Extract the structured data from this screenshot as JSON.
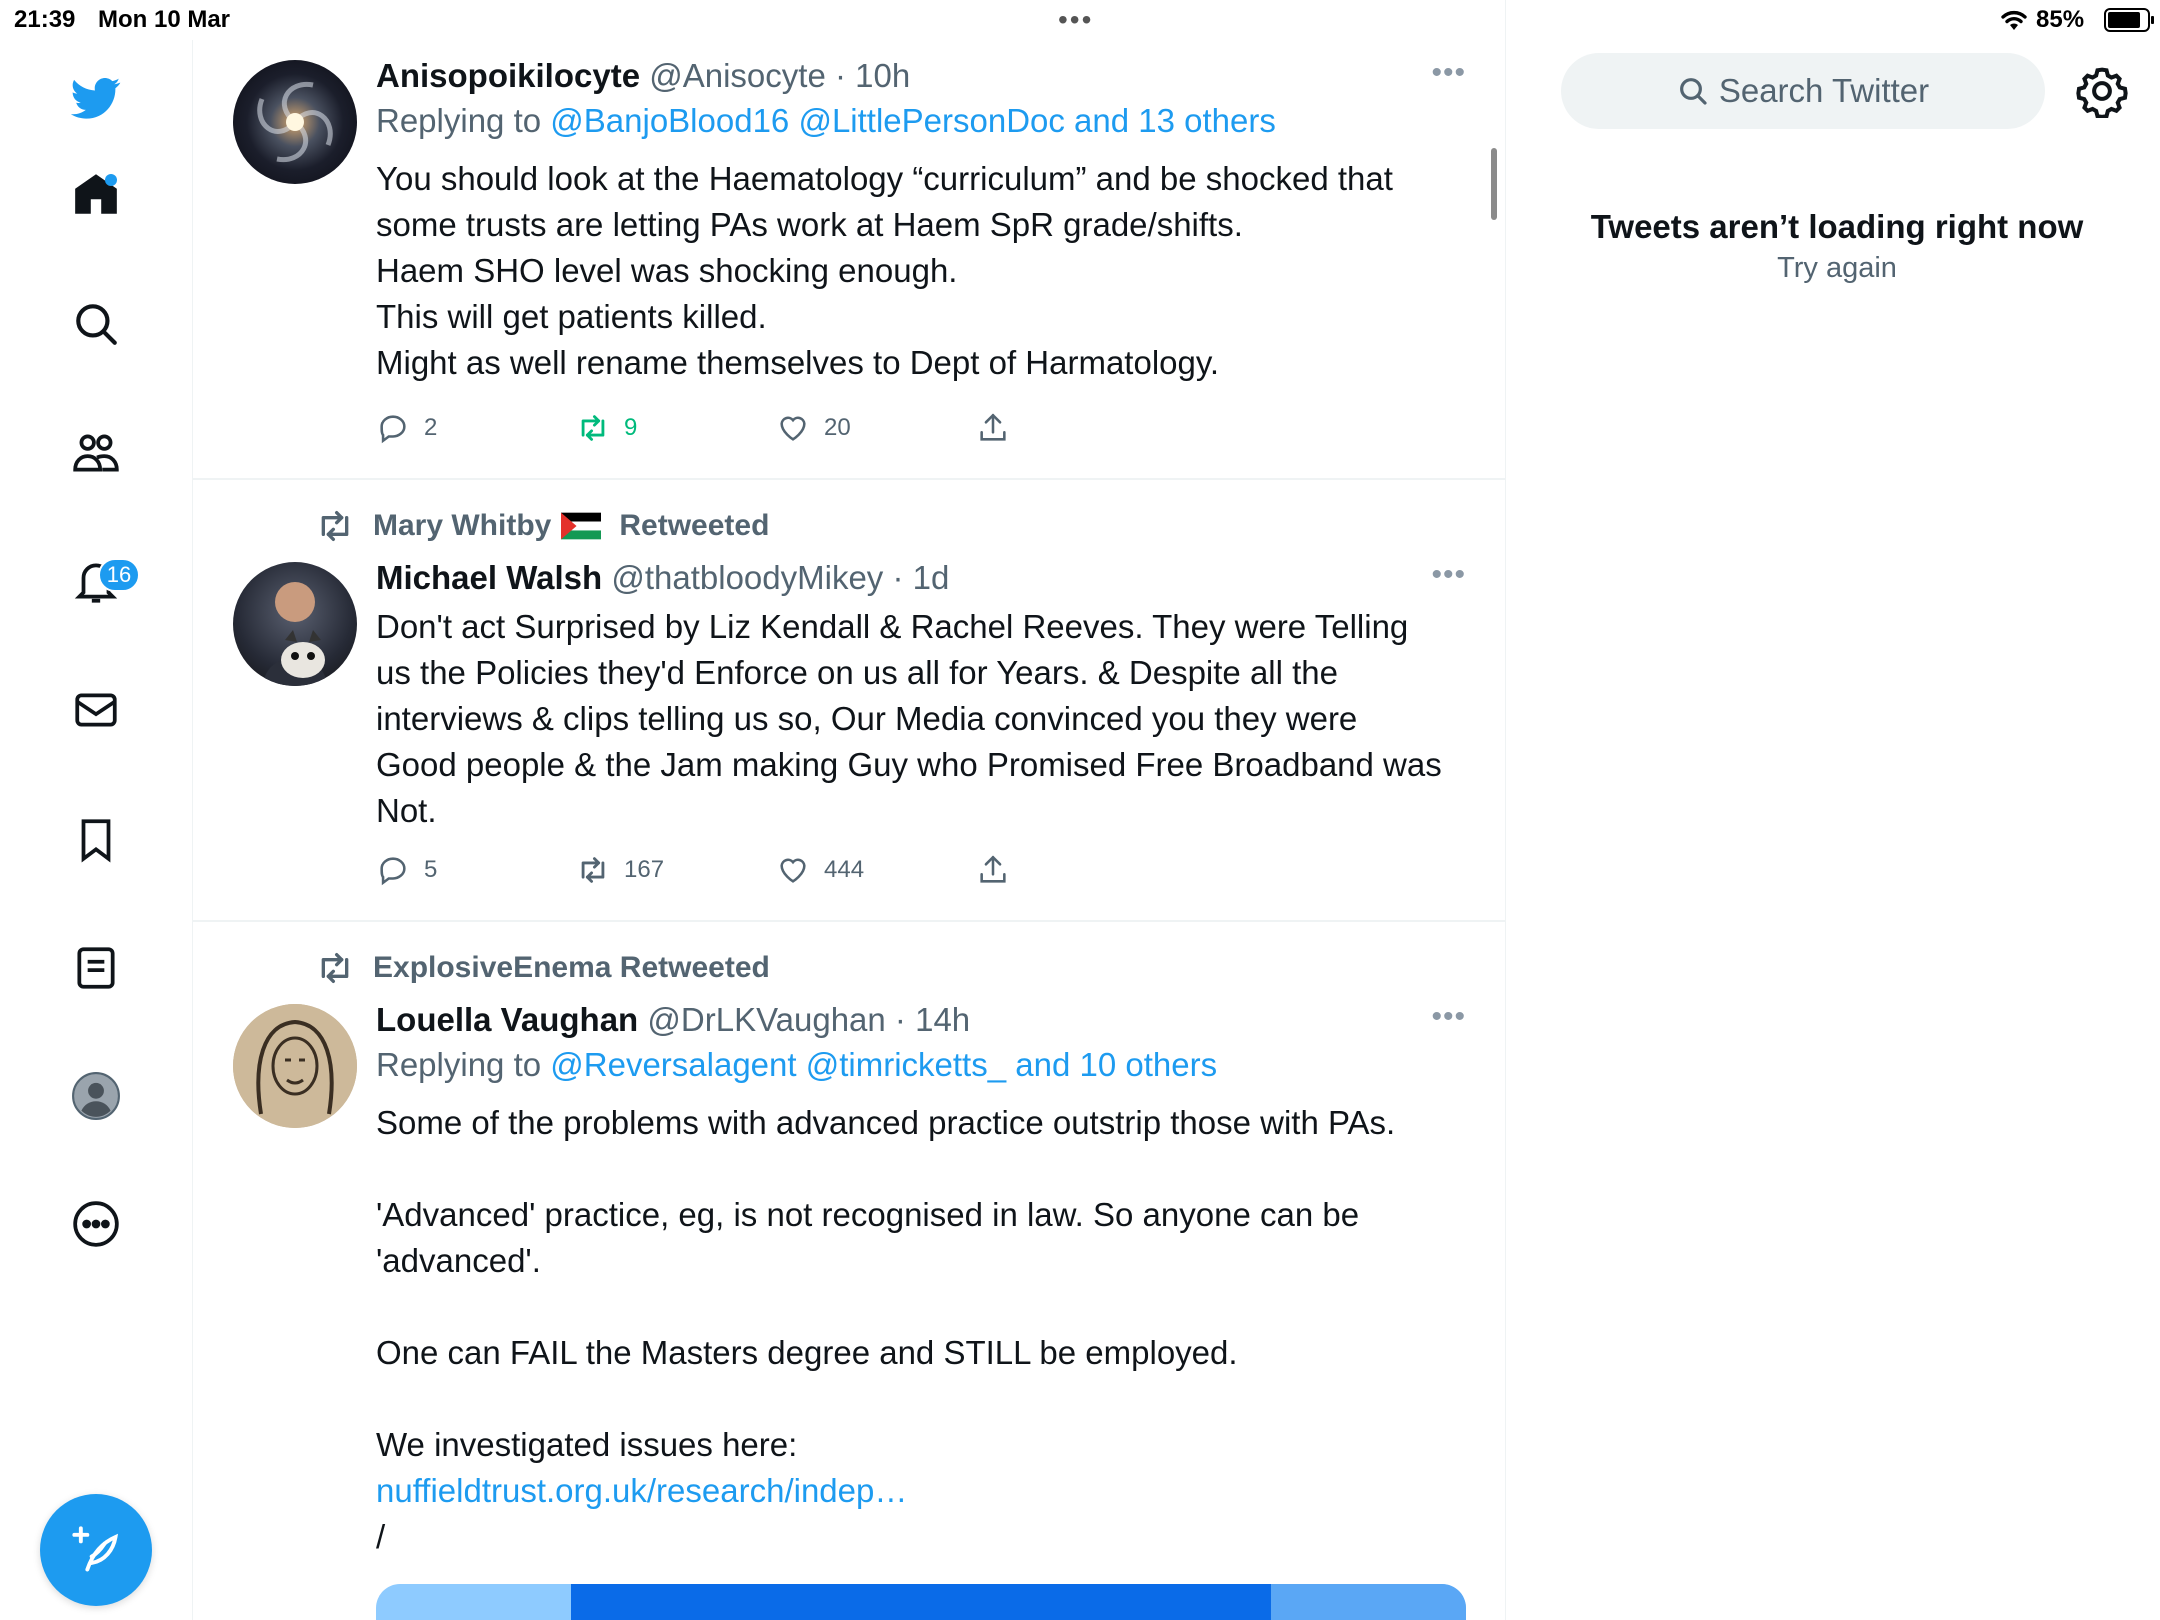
{
  "status_bar": {
    "time": "21:39",
    "date": "Mon 10 Mar",
    "battery_percent": "85%",
    "battery_level": 0.85
  },
  "nav": {
    "notifications_badge": "16",
    "icons": [
      "twitter-bird-icon",
      "home-icon",
      "search-icon",
      "communities-icon",
      "notifications-icon",
      "messages-icon",
      "bookmarks-icon",
      "lists-icon",
      "profile-icon",
      "more-icon"
    ]
  },
  "tweets": [
    {
      "name": "Anisopoikilocyte",
      "handle": "@Anisocyte",
      "sep": " · ",
      "time": "10h",
      "replying_prefix": "Replying to ",
      "replying_mentions": "@BanjoBlood16 @LittlePersonDoc and 13 others",
      "text": "You should look at the Haematology “curriculum” and be shocked that\nsome trusts are letting PAs work at Haem SpR grade/shifts.\nHaem SHO level was shocking enough.\nThis will get patients killed.\nMight as well rename themselves to Dept of Harmatology.",
      "replies": "2",
      "retweets": "9",
      "likes": "20"
    },
    {
      "retweeted_by": "Mary Whitby",
      "retweeted_suffix": "Retweeted",
      "name": "Michael Walsh",
      "handle": "@thatbloodyMikey",
      "sep": " · ",
      "time": "1d",
      "text": "Don't act Surprised by Liz Kendall & Rachel Reeves. They were Telling\nus the Policies they'd Enforce on us all for Years. & Despite all the\ninterviews & clips telling us so, Our Media convinced you they were\nGood people & the Jam making Guy who Promised Free Broadband was\nNot.",
      "replies": "5",
      "retweets": "167",
      "likes": "444"
    },
    {
      "retweeted_by": "ExplosiveEnema",
      "retweeted_suffix": "Retweeted",
      "name": "Louella Vaughan",
      "handle": "@DrLKVaughan",
      "sep": " · ",
      "time": "14h",
      "replying_prefix": "Replying to ",
      "replying_mentions": "@Reversalagent @timricketts_ and 10 others",
      "text": "Some of the problems with advanced practice outstrip those with PAs.\n\n'Advanced' practice, eg, is not recognised in law. So anyone can be\n'advanced'.\n\nOne can FAIL the Masters degree and STILL be employed.\n\nWe investigated issues here:",
      "link": "nuffieldtrust.org.uk/research/indep…",
      "text_after_link": "/"
    }
  ],
  "right": {
    "search_placeholder": "Search Twitter",
    "error_title": "Tweets aren’t loading right now",
    "retry_label": "Try again"
  },
  "colors": {
    "accent": "#1d9bf0",
    "retweet_active": "#00ba7c",
    "secondary_text": "#536471"
  }
}
